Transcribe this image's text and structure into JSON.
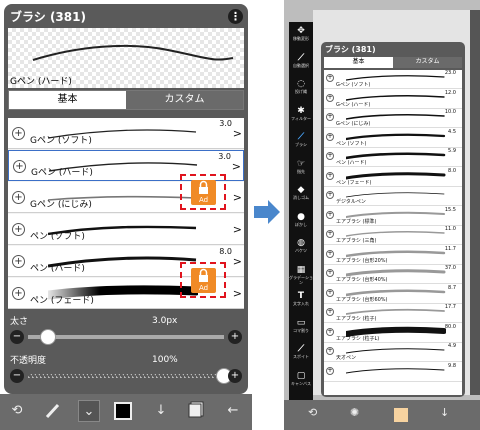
{
  "left": {
    "panel_title": "ブラシ (381)",
    "kebab_icon": "⋮",
    "preview_label": "Gペン (ハード)",
    "tabs": [
      "基本",
      "カスタム"
    ],
    "brushes": [
      {
        "name": "Gペン (ソフト)",
        "size": "3.0",
        "locked": false,
        "selected": false
      },
      {
        "name": "Gペン (ハード)",
        "size": "3.0",
        "locked": false,
        "selected": true
      },
      {
        "name": "Gペン (にじみ)",
        "size": "",
        "locked": true,
        "selected": false
      },
      {
        "name": "ペン (ソフト)",
        "size": "",
        "locked": false,
        "selected": false
      },
      {
        "name": "ペン (ハード)",
        "size": "8.0",
        "locked": false,
        "selected": false
      },
      {
        "name": "ペン (フェード)",
        "size": "",
        "locked": true,
        "selected": false
      }
    ],
    "ad_label": "Ad",
    "size_label": "太さ",
    "size_value": "3.0px",
    "size_fraction": 0.1,
    "opacity_label": "不透明度",
    "opacity_value": "100%",
    "opacity_fraction": 1.0,
    "minus": "−",
    "plus": "+",
    "arrow": ">",
    "toolbar_icons": [
      "transform-icon",
      "brush-icon",
      "chevron-down-icon",
      "color-square-icon",
      "down-arrow-icon",
      "layer-icon",
      "back-arrow-icon"
    ]
  },
  "right": {
    "panel_title": "ブラシ (381)",
    "tabs": [
      "基本",
      "カスタム"
    ],
    "tools": [
      "移動変形",
      "自動選択",
      "投げ縄",
      "フィルター",
      "ブラシ",
      "指先",
      "消しゴム",
      "ぼかし",
      "バケツ",
      "グラデーション",
      "文字入れ",
      "コマ割り",
      "スポイト",
      "キャンバス"
    ],
    "brushes": [
      {
        "name": "Gペン (ソフト)",
        "size": "23.0"
      },
      {
        "name": "Gペン (ハード)",
        "size": "12.0"
      },
      {
        "name": "Gペン (にじみ)",
        "size": "10.0"
      },
      {
        "name": "ペン (ソフト)",
        "size": "4.5"
      },
      {
        "name": "ペン (ハード)",
        "size": "5.9"
      },
      {
        "name": "ペン (フェード)",
        "size": "8.0"
      },
      {
        "name": "デジタルペン",
        "size": ""
      },
      {
        "name": "エアブラシ (標準)",
        "size": "15.5"
      },
      {
        "name": "エアブラシ (三角)",
        "size": "11.0"
      },
      {
        "name": "エアブラシ (台形20%)",
        "size": "11.7"
      },
      {
        "name": "エアブラシ (台形40%)",
        "size": "37.0"
      },
      {
        "name": "エアブラシ (台形60%)",
        "size": "8.7"
      },
      {
        "name": "エアブラシ (粒子)",
        "size": "17.7"
      },
      {
        "name": "エアブラシ (粒子L)",
        "size": "80.0"
      },
      {
        "name": "天オペン",
        "size": "4.9"
      },
      {
        "name": "",
        "size": "9.8"
      }
    ]
  },
  "colors": {
    "accent_blue": "#3b6fc7",
    "lock_orange": "#f08a26",
    "lock_border": "#e0141e",
    "panel_gray": "#5a5a5a"
  }
}
